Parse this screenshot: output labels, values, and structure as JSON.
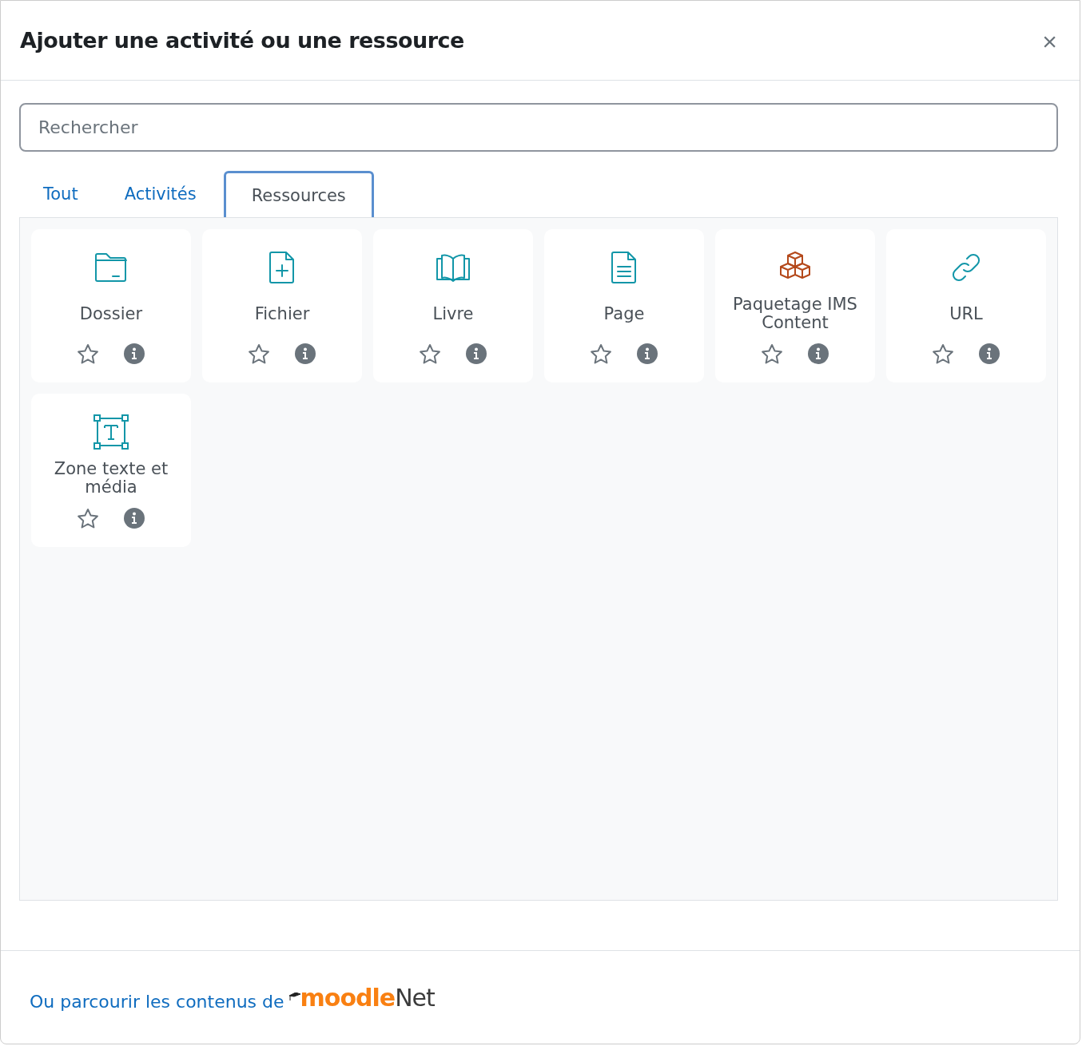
{
  "dialog": {
    "title": "Ajouter une activité ou une ressource",
    "close": "×"
  },
  "search": {
    "placeholder": "Rechercher"
  },
  "tabs": [
    {
      "label": "Tout",
      "selected": false
    },
    {
      "label": "Activités",
      "selected": false
    },
    {
      "label": "Ressources",
      "selected": true
    }
  ],
  "items": [
    {
      "kind": "folder",
      "name": "Dossier",
      "starred": false
    },
    {
      "kind": "file",
      "name": "Fichier",
      "starred": false
    },
    {
      "kind": "book",
      "name": "Livre",
      "starred": false
    },
    {
      "kind": "page",
      "name": "Page",
      "starred": false
    },
    {
      "kind": "package",
      "name": "Paquetage IMS Content",
      "starred": false
    },
    {
      "kind": "link",
      "name": "URL",
      "starred": false
    },
    {
      "kind": "textarea",
      "name": "Zone texte et média",
      "starred": false
    }
  ],
  "footer": {
    "text": "Ou parcourir les contenus de",
    "logo_part_1": "moodle",
    "logo_part_2": "Net"
  }
}
